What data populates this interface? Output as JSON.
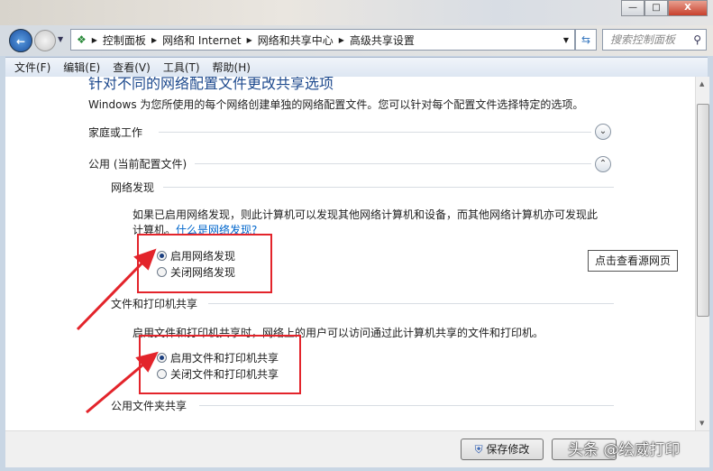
{
  "window": {
    "minimize": "—",
    "maximize": "□",
    "close": "X"
  },
  "address": {
    "crumbs": [
      "控制面板",
      "网络和 Internet",
      "网络和共享中心",
      "高级共享设置"
    ],
    "search_placeholder": "搜索控制面板"
  },
  "menu": [
    "文件(F)",
    "编辑(E)",
    "查看(V)",
    "工具(T)",
    "帮助(H)"
  ],
  "content": {
    "title": "针对不同的网络配置文件更改共享选项",
    "intro": "Windows 为您所使用的每个网络创建单独的网络配置文件。您可以针对每个配置文件选择特定的选项。",
    "profile_home": "家庭或工作",
    "profile_public": "公用 (当前配置文件)",
    "discovery": {
      "heading": "网络发现",
      "desc": "如果已启用网络发现，则此计算机可以发现其他网络计算机和设备，而其他网络计算机亦可发现此计算机。",
      "link": "什么是网络发现?",
      "options": [
        "启用网络发现",
        "关闭网络发现"
      ],
      "selected": 0
    },
    "view_source": "点击查看源网页",
    "sharing": {
      "heading": "文件和打印机共享",
      "desc": "启用文件和打印机共享时，网络上的用户可以访问通过此计算机共享的文件和打印机。",
      "options": [
        "启用文件和打印机共享",
        "关闭文件和打印机共享"
      ],
      "selected": 0
    },
    "public_folder": "公用文件夹共享"
  },
  "footer": {
    "save": "保存修改"
  },
  "watermark": "头条 @绘威打印",
  "colors": {
    "annotation": "#e3242b",
    "title": "#1e4a8e",
    "link": "#0066cc"
  }
}
